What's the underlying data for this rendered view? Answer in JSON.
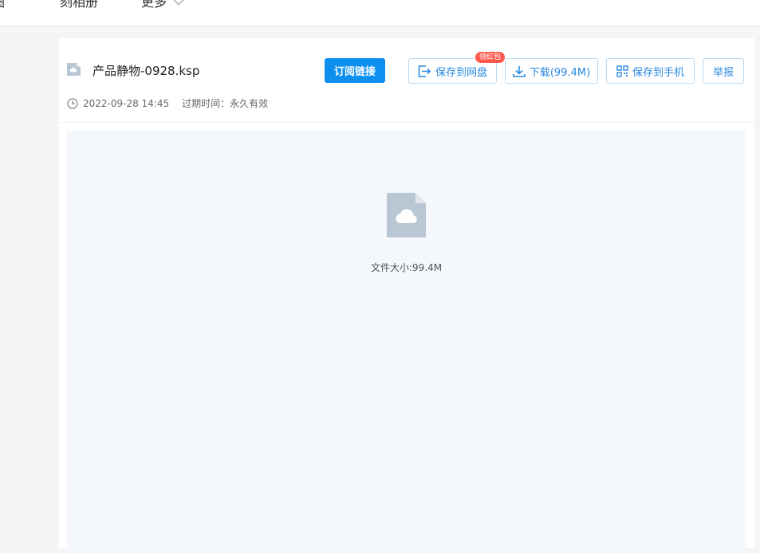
{
  "nav": {
    "items": [
      "圈",
      "刻相册",
      "更多"
    ]
  },
  "file": {
    "name": "产品静物-0928.ksp",
    "date": "2022-09-28 14:45",
    "expire_label": "过期时间：",
    "expire_value": "永久有效",
    "size_text": "文件大小:99.4M"
  },
  "actions": {
    "subscribe": "订阅链接",
    "save_to_disk": "保存到网盘",
    "save_badge": "领红包",
    "download": "下载(99.4M)",
    "save_to_phone": "保存到手机",
    "report": "举报"
  },
  "colors": {
    "accent": "#0d8ff0",
    "badge": "#ff5a4d",
    "icon_gray": "#b9c6d3"
  }
}
